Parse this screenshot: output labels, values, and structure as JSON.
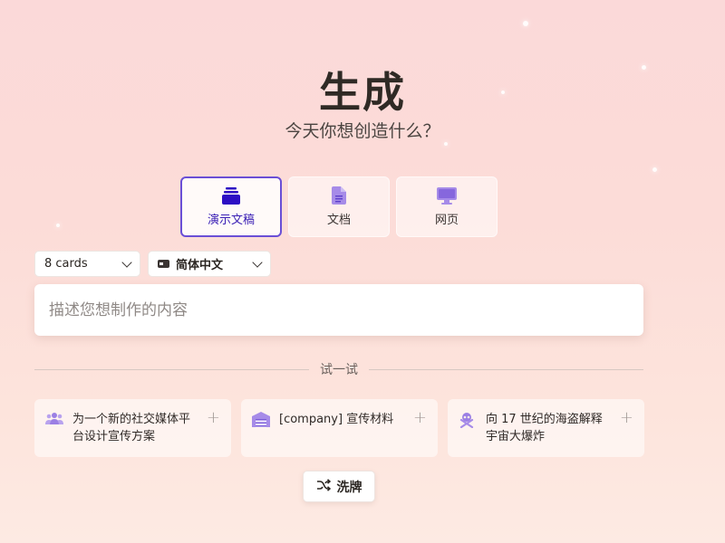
{
  "header": {
    "title": "生成",
    "subtitle": "今天你想创造什么？"
  },
  "type_tabs": [
    {
      "label": "演示文稿",
      "icon": "stack-icon",
      "active": true
    },
    {
      "label": "文档",
      "icon": "document-icon",
      "active": false
    },
    {
      "label": "网页",
      "icon": "monitor-icon",
      "active": false
    }
  ],
  "selectors": {
    "cards_value": "8 cards",
    "language_value": "简体中文"
  },
  "prompt": {
    "placeholder": "描述您想制作的内容",
    "value": ""
  },
  "divider_label": "试一试",
  "suggestions": [
    {
      "text": "为一个新的社交媒体平台设计宣传方案",
      "icon": "users-icon"
    },
    {
      "text": "[company] 宣传材料",
      "icon": "warehouse-icon"
    },
    {
      "text": "向 17 世纪的海盗解释宇宙大爆炸",
      "icon": "skull-crossbones-icon"
    }
  ],
  "shuffle_label": "洗牌",
  "colors": {
    "accent": "#6a4fd6",
    "accent_text": "#3a1fb5",
    "icon_purple": "#8b6be0"
  }
}
